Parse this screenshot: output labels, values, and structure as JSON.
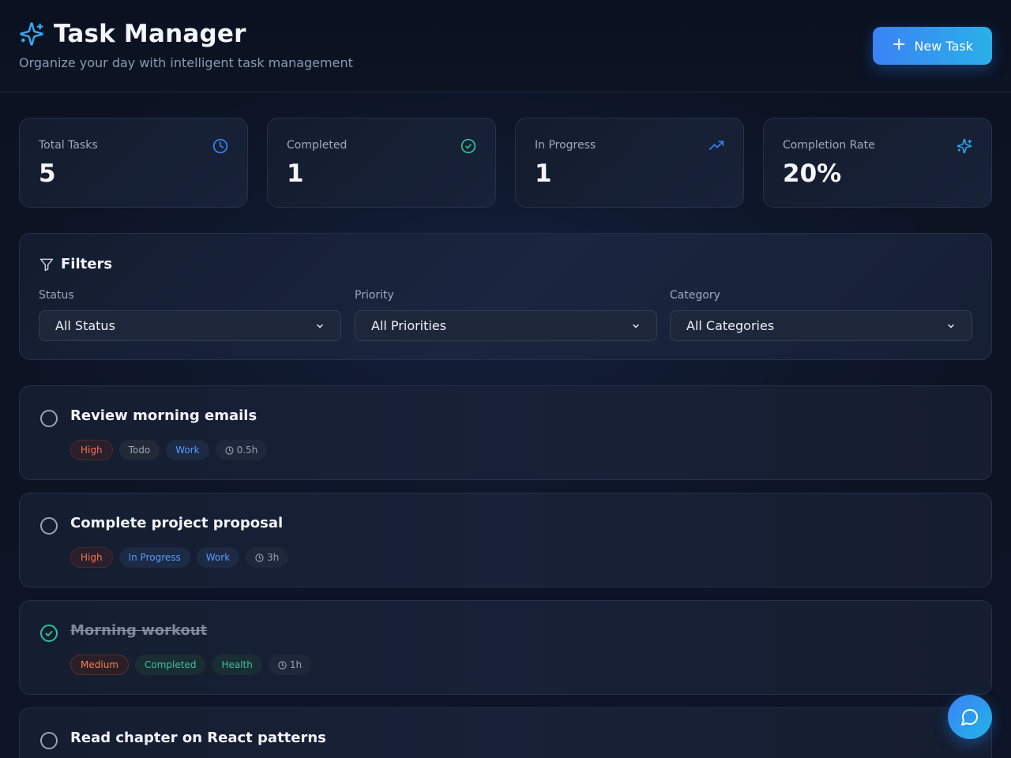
{
  "header": {
    "title": "Task Manager",
    "subtitle": "Organize your day with intelligent task management",
    "new_task_label": "New Task",
    "brand_icon": "sparkles-icon"
  },
  "stats": [
    {
      "label": "Total Tasks",
      "value": "5",
      "icon": "clock-icon",
      "color": "#3b82f6"
    },
    {
      "label": "Completed",
      "value": "1",
      "icon": "check-circle-icon",
      "color": "#2fbf9a"
    },
    {
      "label": "In Progress",
      "value": "1",
      "icon": "trending-up-icon",
      "color": "#3b82f6"
    },
    {
      "label": "Completion Rate",
      "value": "20%",
      "icon": "sparkles-icon",
      "color": "#2aa4e6"
    }
  ],
  "filters": {
    "title": "Filters",
    "status": {
      "label": "Status",
      "selected": "All Status"
    },
    "priority": {
      "label": "Priority",
      "selected": "All Priorities"
    },
    "category": {
      "label": "Category",
      "selected": "All Categories"
    }
  },
  "tasks": [
    {
      "title": "Review morning emails",
      "done": false,
      "priority": "High",
      "status": "Todo",
      "category": "Work",
      "duration": "0.5h"
    },
    {
      "title": "Complete project proposal",
      "done": false,
      "priority": "High",
      "status": "In Progress",
      "category": "Work",
      "duration": "3h"
    },
    {
      "title": "Morning workout",
      "done": true,
      "priority": "Medium",
      "status": "Completed",
      "category": "Health",
      "duration": "1h"
    },
    {
      "title": "Read chapter on React patterns",
      "done": false
    }
  ],
  "colors": {
    "accent": "#3b82f6",
    "accent_cyan": "#22b4e6",
    "success": "#2fbf9a",
    "danger": "#f2735a"
  },
  "chat_icon": "message-circle-icon"
}
